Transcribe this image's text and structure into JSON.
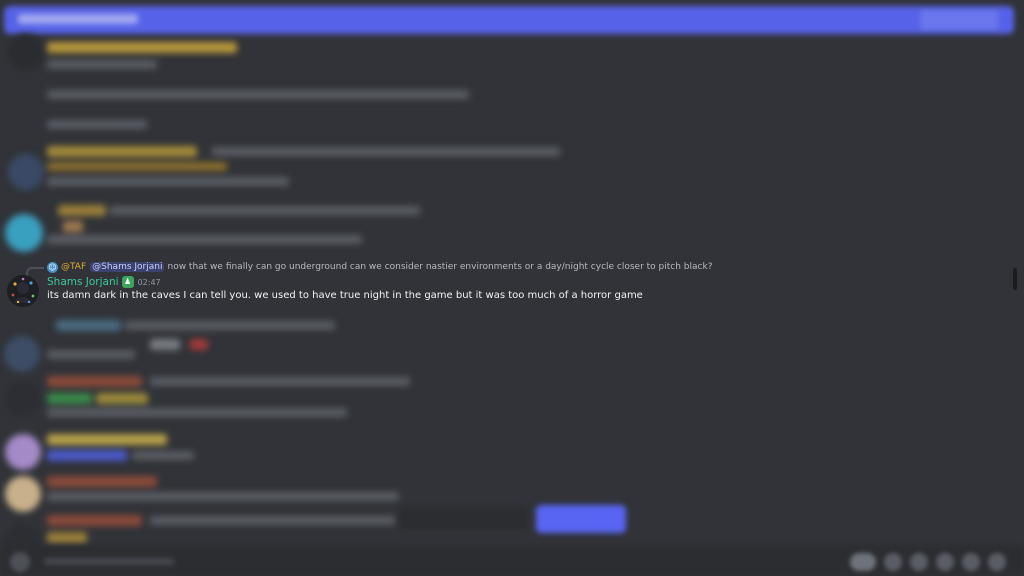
{
  "focused_message": {
    "reply": {
      "author": "@TAF",
      "mention": "@Shams Jorjani",
      "text": "now that we finally can go underground can we consider nastier environments or a day/night cycle closer to pitch black?"
    },
    "author": "Shams Jorjani",
    "time": "02:47",
    "text": "its damn dark in the caves I can tell you. we used to have true night in the game but it was too much of a horror game"
  },
  "colors": {
    "background": "#313338",
    "banner": "#5865f2",
    "author_name": "#3ec99b",
    "reply_author": "#e0a833",
    "mention_bg": "#3c4270",
    "mention_text": "#c9cdfb",
    "badge": "#3ba55c"
  },
  "icons": {
    "reply_author_icon": "avatar-icon",
    "author_badge": "person-badge-icon",
    "composer_add": "plus-circle-icon",
    "composer_tools": [
      "gift-icon",
      "gif-icon",
      "sticker-icon",
      "emoji-icon",
      "apps-icon"
    ]
  }
}
